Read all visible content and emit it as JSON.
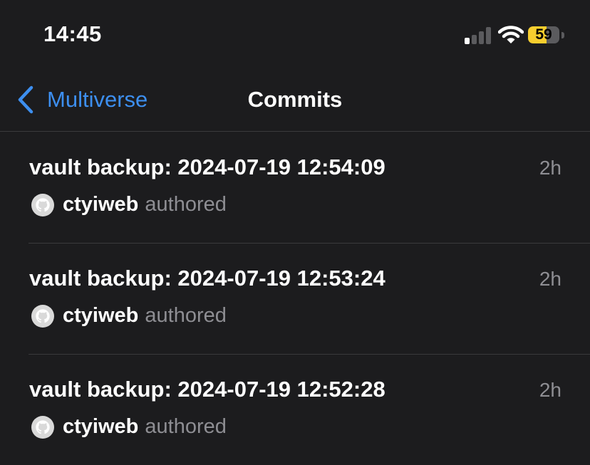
{
  "status_bar": {
    "time": "14:45",
    "battery_level": "59",
    "battery_color": "#f7ce2e",
    "signal_bars_active": 1,
    "signal_bars_total": 4,
    "icons": [
      "cellular-signal-icon",
      "wifi-icon",
      "battery-icon"
    ]
  },
  "nav": {
    "back_label": "Multiverse",
    "back_icon": "chevron-left-icon",
    "title": "Commits",
    "accent_color": "#3d8ff0"
  },
  "commits": [
    {
      "message": "vault backup: 2024-07-19 12:54:09",
      "author": "ctyiweb",
      "action": "authored",
      "age": "2h",
      "avatar_icon": "github-octocat-icon"
    },
    {
      "message": "vault backup: 2024-07-19 12:53:24",
      "author": "ctyiweb",
      "action": "authored",
      "age": "2h",
      "avatar_icon": "github-octocat-icon"
    },
    {
      "message": "vault backup: 2024-07-19 12:52:28",
      "author": "ctyiweb",
      "action": "authored",
      "age": "2h",
      "avatar_icon": "github-octocat-icon"
    }
  ]
}
